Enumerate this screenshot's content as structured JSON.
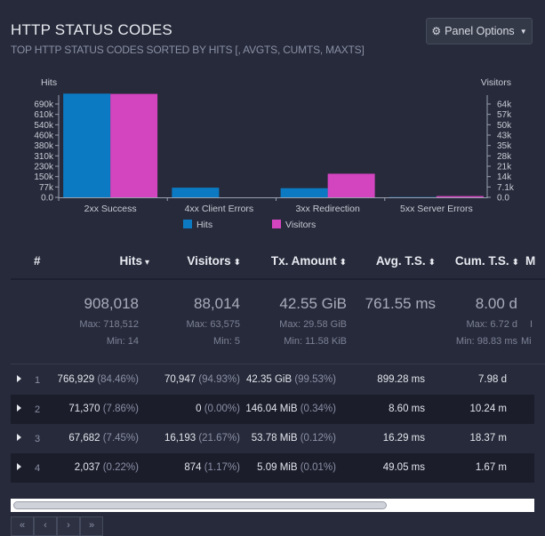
{
  "header": {
    "title": "HTTP STATUS CODES",
    "subtitle": "TOP HTTP STATUS CODES SORTED BY HITS [, AVGTS, CUMTS, MAXTS]",
    "panel_options": "Panel Options",
    "gear_icon": "gear-icon",
    "chevron_icon": "chevron-down-icon"
  },
  "chart_data": {
    "type": "bar",
    "categories": [
      "2xx Success",
      "4xx Client Errors",
      "3xx Redirection",
      "5xx Server Errors"
    ],
    "series": [
      {
        "name": "Hits",
        "values": [
          766929,
          71370,
          67682,
          2037
        ],
        "color": "#0c7ac2",
        "axis": "left"
      },
      {
        "name": "Visitors",
        "values": [
          70947,
          0,
          16193,
          874
        ],
        "color": "#d344bf",
        "axis": "right"
      }
    ],
    "ylabel_left": "Hits",
    "ylabel_right": "Visitors",
    "left_ticks": [
      "0.0",
      "77k",
      "150k",
      "230k",
      "310k",
      "380k",
      "460k",
      "540k",
      "610k",
      "690k"
    ],
    "right_ticks": [
      "0.0",
      "7.1k",
      "14k",
      "21k",
      "28k",
      "35k",
      "43k",
      "50k",
      "57k",
      "64k"
    ],
    "ylim_left": [
      0,
      690000
    ],
    "ylim_right": [
      0,
      64000
    ]
  },
  "table": {
    "columns": [
      {
        "label": "#",
        "arrow": ""
      },
      {
        "label": "Hits",
        "arrow": "▾"
      },
      {
        "label": "Visitors",
        "arrow": "⬍"
      },
      {
        "label": "Tx. Amount",
        "arrow": "⬍"
      },
      {
        "label": "Avg. T.S.",
        "arrow": "⬍"
      },
      {
        "label": "Cum. T.S.",
        "arrow": "⬍"
      },
      {
        "label": "M",
        "arrow": ""
      }
    ],
    "summary": {
      "hits": {
        "total": "908,018",
        "max": "Max: 718,512",
        "min": "Min: 14"
      },
      "visitors": {
        "total": "88,014",
        "max": "Max: 63,575",
        "min": "Min: 5"
      },
      "tx": {
        "total": "42.55 GiB",
        "max": "Max: 29.58 GiB",
        "min": "Min: 11.58 KiB"
      },
      "avg": {
        "total": "761.55 ms"
      },
      "cum": {
        "total": "8.00 d",
        "max": "Max: 6.72 d",
        "min": "Min: 98.83 ms"
      },
      "extra": {
        "max": "I",
        "min": "Mi"
      }
    },
    "rows": [
      {
        "idx": "1",
        "hits": "766,929",
        "hits_pct": "(84.46%)",
        "visitors": "70,947",
        "visitors_pct": "(94.93%)",
        "tx": "42.35 GiB",
        "tx_pct": "(99.53%)",
        "avg": "899.28 ms",
        "cum": "7.98 d"
      },
      {
        "idx": "2",
        "hits": "71,370",
        "hits_pct": "(7.86%)",
        "visitors": "0",
        "visitors_pct": "(0.00%)",
        "tx": "146.04 MiB",
        "tx_pct": "(0.34%)",
        "avg": "8.60 ms",
        "cum": "10.24 m"
      },
      {
        "idx": "3",
        "hits": "67,682",
        "hits_pct": "(7.45%)",
        "visitors": "16,193",
        "visitors_pct": "(21.67%)",
        "tx": "53.78 MiB",
        "tx_pct": "(0.12%)",
        "avg": "16.29 ms",
        "cum": "18.37 m"
      },
      {
        "idx": "4",
        "hits": "2,037",
        "hits_pct": "(0.22%)",
        "visitors": "874",
        "visitors_pct": "(1.17%)",
        "tx": "5.09 MiB",
        "tx_pct": "(0.01%)",
        "avg": "49.05 ms",
        "cum": "1.67 m"
      }
    ]
  },
  "pager": {
    "first": "«",
    "prev": "‹",
    "next": "›",
    "last": "»"
  }
}
